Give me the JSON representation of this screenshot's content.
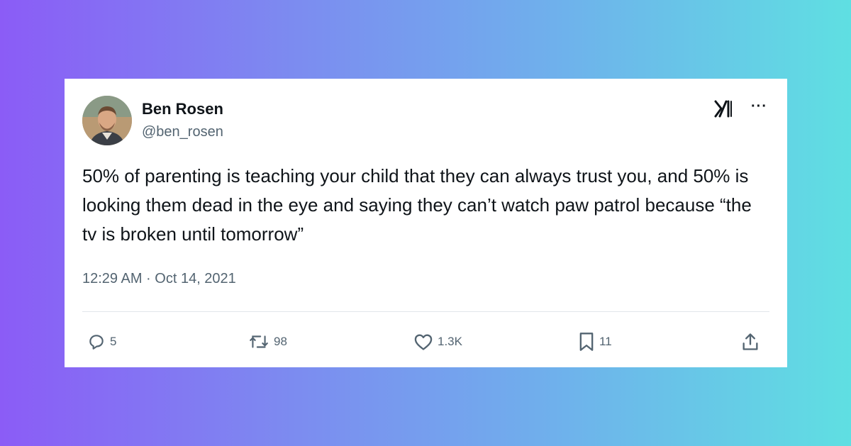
{
  "tweet": {
    "author_name": "Ben Rosen",
    "author_handle": "@ben_rosen",
    "text": "50% of parenting is teaching your child that they can always trust you, and 50% is looking them dead in the eye and saying they can’t watch paw patrol because “the tv is broken until tomorrow”",
    "timestamp": "12:29 AM · Oct 14, 2021",
    "more_label": "···",
    "brand_icon": "x-logo-icon",
    "avatar": "profile-photo"
  },
  "actions": {
    "replies": {
      "icon": "reply-icon",
      "count": "5"
    },
    "reposts": {
      "icon": "repost-icon",
      "count": "98"
    },
    "likes": {
      "icon": "heart-icon",
      "count": "1.3K"
    },
    "bookmarks": {
      "icon": "bookmark-icon",
      "count": "11"
    },
    "share": {
      "icon": "share-icon"
    }
  },
  "colors": {
    "background_start": "#8b5cf6",
    "background_end": "#5fdfe2",
    "card": "#ffffff",
    "text_primary": "#0f1419",
    "text_secondary": "#536471"
  }
}
